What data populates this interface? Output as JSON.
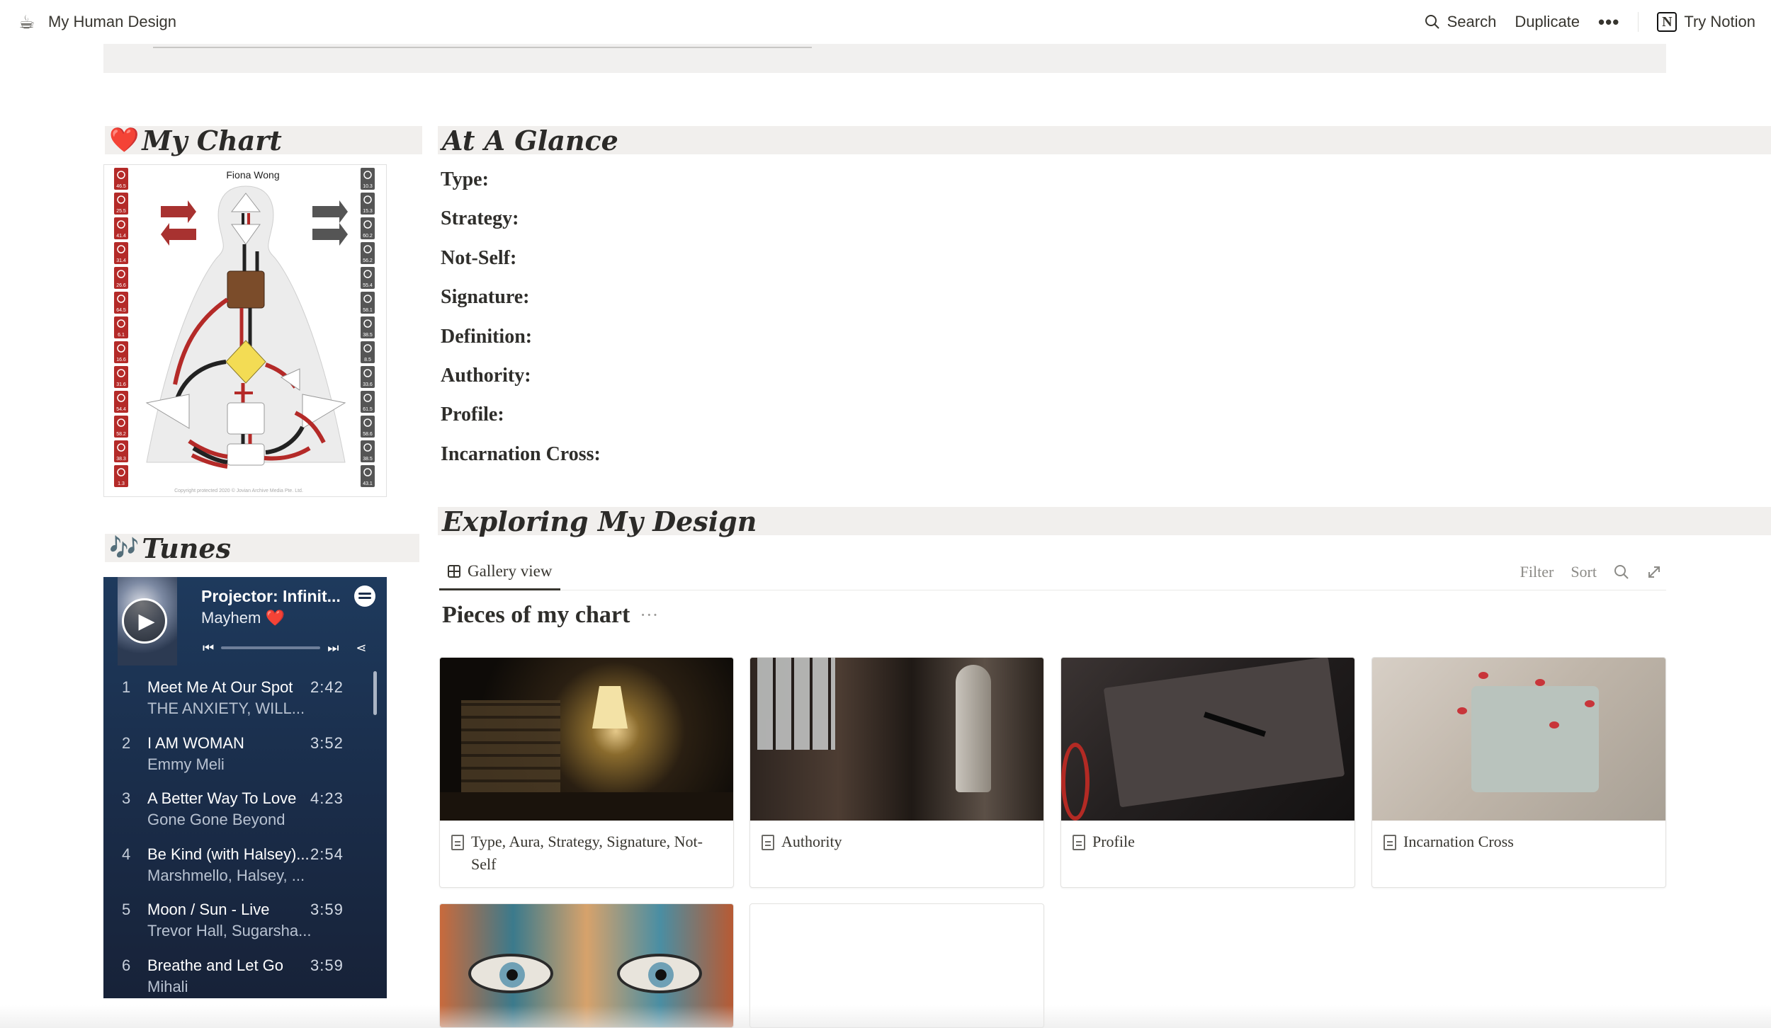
{
  "topbar": {
    "page_icon": "☕",
    "breadcrumb": "My Human Design",
    "search_label": "Search",
    "duplicate_label": "Duplicate",
    "more_label": "•••",
    "try_notion_label": "Try Notion"
  },
  "my_chart": {
    "emoji": "❤️",
    "heading": "My Chart",
    "chart_name": "Fiona Wong",
    "left_values": [
      "46.5",
      "25.5",
      "41.4",
      "31.4",
      "26.6",
      "64.5",
      "6.1",
      "16.6",
      "31.6",
      "54.4",
      "58.2",
      "38.3",
      "1.3"
    ],
    "right_values": [
      "10.3",
      "15.3",
      "60.2",
      "56.2",
      "55.4",
      "58.1",
      "38.5",
      "8.5",
      "33.6",
      "61.5",
      "58.6",
      "38.5",
      "43.1"
    ],
    "copyright": "Copyright protected 2020 © Jovian Archive Media Pte. Ltd."
  },
  "at_a_glance": {
    "heading": "At A Glance",
    "rows": [
      "Type:",
      "Strategy:",
      "Not-Self:",
      "Signature:",
      "Definition:",
      "Authority:",
      "Profile:",
      "Incarnation Cross:"
    ]
  },
  "tunes": {
    "emoji": "🎶",
    "heading": "Tunes",
    "now_playing": {
      "title": "Projector: Infinit...",
      "artist": "Mayhem ❤️"
    },
    "tracks": [
      {
        "num": "1",
        "name": "Meet Me At Our Spot",
        "artist": "THE ANXIETY, WILL...",
        "duration": "2:42"
      },
      {
        "num": "2",
        "name": "I AM WOMAN",
        "artist": "Emmy Meli",
        "duration": "3:52"
      },
      {
        "num": "3",
        "name": "A Better Way To Love",
        "artist": "Gone Gone Beyond",
        "duration": "4:23"
      },
      {
        "num": "4",
        "name": "Be Kind (with Halsey)...",
        "artist": "Marshmello, Halsey, ...",
        "duration": "2:54"
      },
      {
        "num": "5",
        "name": "Moon / Sun - Live",
        "artist": "Trevor Hall, Sugarsha...",
        "duration": "3:59"
      },
      {
        "num": "6",
        "name": "Breathe and Let Go",
        "artist": "Mihali",
        "duration": "3:59"
      }
    ]
  },
  "exploring": {
    "heading": "Exploring My Design",
    "view_tab": "Gallery view",
    "filter_label": "Filter",
    "sort_label": "Sort",
    "collection_title": "Pieces of my chart",
    "collection_more": "···",
    "cards": [
      {
        "title": "Type, Aura, Strategy, Signature, Not-Self"
      },
      {
        "title": "Authority"
      },
      {
        "title": "Profile"
      },
      {
        "title": "Incarnation Cross"
      }
    ]
  },
  "colors": {
    "header_bg": "#f1efed",
    "spotify_bg": "#1e3a5d",
    "chart_red": "#b42a28",
    "chart_dark": "#555555"
  }
}
